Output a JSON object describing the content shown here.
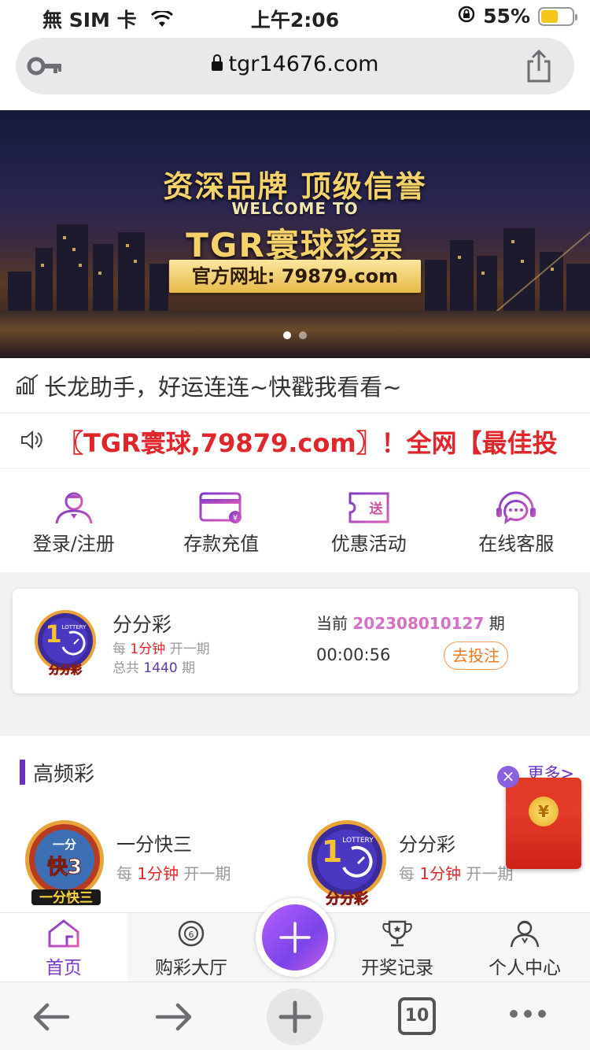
{
  "status": {
    "carrier": "無 SIM 卡",
    "time": "上午2:06",
    "battery": "55%",
    "battery_level": 0.55
  },
  "browser": {
    "url": "tgr14676.com"
  },
  "banner": {
    "line1": "资深品牌 顶级信誉",
    "line2": "WELCOME TO",
    "line3": "TGR寰球彩票",
    "plate": "官方网址: 79879.com",
    "slide_count": 2,
    "active_slide": 1
  },
  "changlong": {
    "text": "长龙助手，好运连连~快戳我看看~"
  },
  "notice": {
    "text": "〖TGR寰球,79879.com〗！全网【最佳投"
  },
  "quick_menu": {
    "items": [
      {
        "label": "登录/注册",
        "icon": "user-icon"
      },
      {
        "label": "存款充值",
        "icon": "card-icon"
      },
      {
        "label": "优惠活动",
        "icon": "ticket-icon"
      },
      {
        "label": "在线客服",
        "icon": "headset-icon"
      }
    ]
  },
  "current_game": {
    "logo_caption": "分分彩",
    "logo_badge": "LOTTERY",
    "name": "分分彩",
    "every_prefix": "每",
    "interval": "1分钟",
    "every_suffix": "开一期",
    "total_prefix": "总共",
    "total": "1440",
    "total_suffix": "期",
    "period_prefix": "当前",
    "period": "202308010127",
    "period_suffix": "期",
    "countdown": "00:00:56",
    "bet_button": "去投注"
  },
  "high_freq": {
    "title": "高频彩",
    "more": "更多>",
    "games": [
      {
        "name": "一分快三",
        "every_prefix": "每",
        "interval": "1分钟",
        "every_suffix": "开一期",
        "logo_top": "一分",
        "logo_mid": "快3",
        "logo_caption": "一分快三"
      },
      {
        "name": "分分彩",
        "every_prefix": "每",
        "interval": "1分钟",
        "every_suffix": "开一期",
        "logo_badge": "LOTTERY",
        "logo_caption": "分分彩"
      }
    ]
  },
  "red_packet": {
    "coin": "¥",
    "close": "×"
  },
  "tabbar": {
    "items": [
      {
        "label": "首页",
        "active": true
      },
      {
        "label": "购彩大厅",
        "active": false
      },
      {
        "label": "开奖记录",
        "active": false
      },
      {
        "label": "个人中心",
        "active": false
      }
    ],
    "center_icon": "plus-icon"
  },
  "browser_bar": {
    "tabs_count": "10"
  },
  "colors": {
    "accent": "#7a3ac9",
    "notice_red": "#e0262b",
    "period_pink": "#d66fc7",
    "bet_orange": "#ef7a1e"
  }
}
